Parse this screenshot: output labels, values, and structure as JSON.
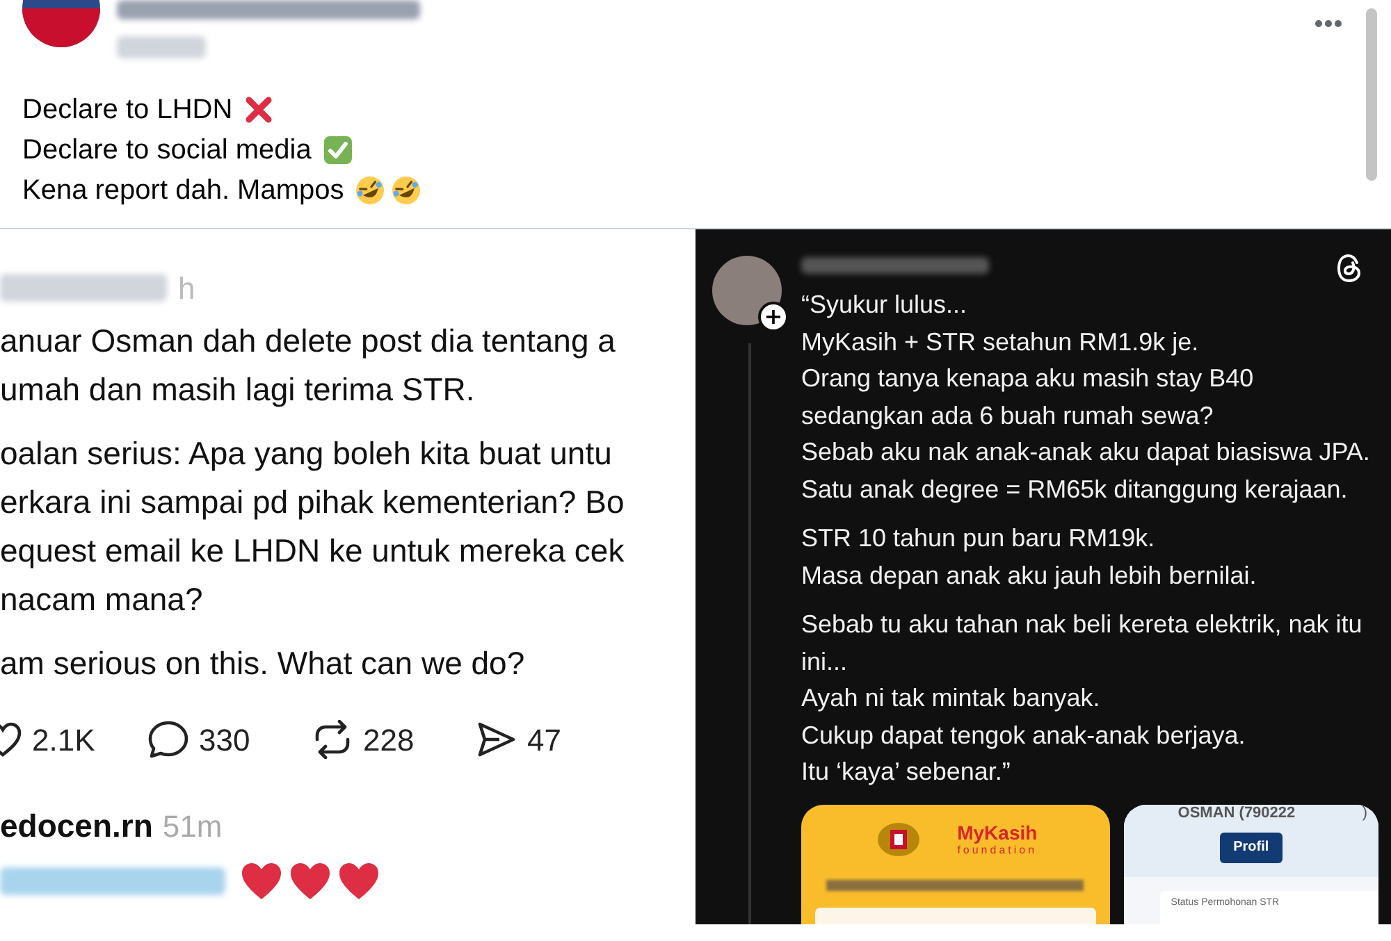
{
  "post": {
    "lines": [
      {
        "text": "Declare to LHDN",
        "emojis": [
          {
            "kind": "cross"
          }
        ]
      },
      {
        "text": "Declare to social media",
        "emojis": [
          {
            "kind": "check"
          }
        ]
      },
      {
        "text": "Kena report dah. Mampos",
        "emojis": [
          {
            "kind": "rofl"
          },
          {
            "kind": "rofl"
          }
        ]
      }
    ]
  },
  "left_screenshot": {
    "time": "h",
    "paragraphs": [
      [
        "anuar Osman dah delete post dia tentang a",
        "umah dan masih lagi terima STR."
      ],
      [
        "oalan serius: Apa yang boleh kita buat  untu",
        "erkara ini sampai pd pihak kementerian? Bo",
        "equest email ke LHDN ke untuk mereka cek",
        "nacam mana?"
      ],
      [
        "am serious on this. What can we do?"
      ]
    ],
    "stats": [
      {
        "kind": "like",
        "count": "2.1K"
      },
      {
        "kind": "reply",
        "count": "330"
      },
      {
        "kind": "repost",
        "count": "228"
      },
      {
        "kind": "share",
        "count": "47"
      }
    ],
    "reply": {
      "username": "edocen.rn",
      "time": "51m",
      "emojis": [
        {
          "kind": "heart"
        },
        {
          "kind": "heart"
        },
        {
          "kind": "heart"
        }
      ]
    }
  },
  "right_screenshot": {
    "paragraphs": [
      [
        "“Syukur lulus...",
        "MyKasih + STR setahun RM1.9k je.",
        "Orang tanya kenapa aku masih stay B40",
        "sedangkan ada 6 buah rumah sewa?",
        "Sebab aku nak anak-anak aku dapat biasiswa JPA.",
        "Satu anak degree = RM65k ditanggung kerajaan."
      ],
      [
        "STR 10 tahun pun baru RM19k.",
        "Masa depan anak aku jauh lebih bernilai."
      ],
      [
        "Sebab tu aku tahan nak beli kereta elektrik, nak itu ini...",
        "Ayah ni tak mintak banyak.",
        "Cukup dapat tengok anak-anak berjaya.",
        "Itu ‘kaya’ sebenar.”"
      ]
    ],
    "cards": [
      {
        "kind": "mykasih",
        "brand": "MyKasih",
        "subtitle": "foundation"
      },
      {
        "kind": "profile",
        "name": "OSMAN (790222",
        "name_end": ")",
        "button": "Profil",
        "status": "Status Permohonan STR"
      }
    ]
  }
}
